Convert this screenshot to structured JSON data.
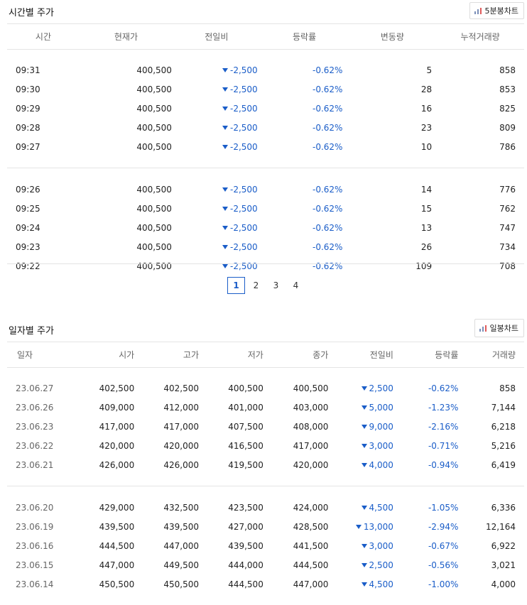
{
  "hourly": {
    "title": "시간별 주가",
    "chart_button": "5분봉차트",
    "headers": [
      "시간",
      "현재가",
      "전일비",
      "등락률",
      "변동량",
      "누적거래량"
    ],
    "groups": [
      [
        [
          "09:31",
          "400,500",
          "-2,500",
          "-0.62%",
          "5",
          "858"
        ],
        [
          "09:30",
          "400,500",
          "-2,500",
          "-0.62%",
          "28",
          "853"
        ],
        [
          "09:29",
          "400,500",
          "-2,500",
          "-0.62%",
          "16",
          "825"
        ],
        [
          "09:28",
          "400,500",
          "-2,500",
          "-0.62%",
          "23",
          "809"
        ],
        [
          "09:27",
          "400,500",
          "-2,500",
          "-0.62%",
          "10",
          "786"
        ]
      ],
      [
        [
          "09:26",
          "400,500",
          "-2,500",
          "-0.62%",
          "14",
          "776"
        ],
        [
          "09:25",
          "400,500",
          "-2,500",
          "-0.62%",
          "15",
          "762"
        ],
        [
          "09:24",
          "400,500",
          "-2,500",
          "-0.62%",
          "13",
          "747"
        ],
        [
          "09:23",
          "400,500",
          "-2,500",
          "-0.62%",
          "26",
          "734"
        ],
        [
          "09:22",
          "400,500",
          "-2,500",
          "-0.62%",
          "109",
          "708"
        ]
      ]
    ]
  },
  "pagination": {
    "pages": [
      "1",
      "2",
      "3",
      "4"
    ],
    "active": "1"
  },
  "daily": {
    "title": "일자별 주가",
    "chart_button": "일봉차트",
    "headers": [
      "일자",
      "시가",
      "고가",
      "저가",
      "종가",
      "전일비",
      "등락률",
      "거래량"
    ],
    "groups": [
      [
        [
          "23.06.27",
          "402,500",
          "402,500",
          "400,500",
          "400,500",
          "2,500",
          "-0.62%",
          "858"
        ],
        [
          "23.06.26",
          "409,000",
          "412,000",
          "401,000",
          "403,000",
          "5,000",
          "-1.23%",
          "7,144"
        ],
        [
          "23.06.23",
          "417,000",
          "417,000",
          "407,500",
          "408,000",
          "9,000",
          "-2.16%",
          "6,218"
        ],
        [
          "23.06.22",
          "420,000",
          "420,000",
          "416,500",
          "417,000",
          "3,000",
          "-0.71%",
          "5,216"
        ],
        [
          "23.06.21",
          "426,000",
          "426,000",
          "419,500",
          "420,000",
          "4,000",
          "-0.94%",
          "6,419"
        ]
      ],
      [
        [
          "23.06.20",
          "429,000",
          "432,500",
          "423,500",
          "424,000",
          "4,500",
          "-1.05%",
          "6,336"
        ],
        [
          "23.06.19",
          "439,500",
          "439,500",
          "427,000",
          "428,500",
          "13,000",
          "-2.94%",
          "12,164"
        ],
        [
          "23.06.16",
          "444,500",
          "447,000",
          "439,500",
          "441,500",
          "3,000",
          "-0.67%",
          "6,922"
        ],
        [
          "23.06.15",
          "447,000",
          "449,500",
          "444,000",
          "444,500",
          "2,500",
          "-0.56%",
          "3,021"
        ],
        [
          "23.06.14",
          "450,500",
          "450,500",
          "444,500",
          "447,000",
          "4,500",
          "-1.00%",
          "4,000"
        ]
      ]
    ]
  },
  "colors": {
    "down": "#1a5dc8",
    "border": "#e4e4e4",
    "muted": "#666666"
  },
  "icons": {
    "chart": "bar-chart-icon",
    "down": "down-triangle-icon"
  }
}
